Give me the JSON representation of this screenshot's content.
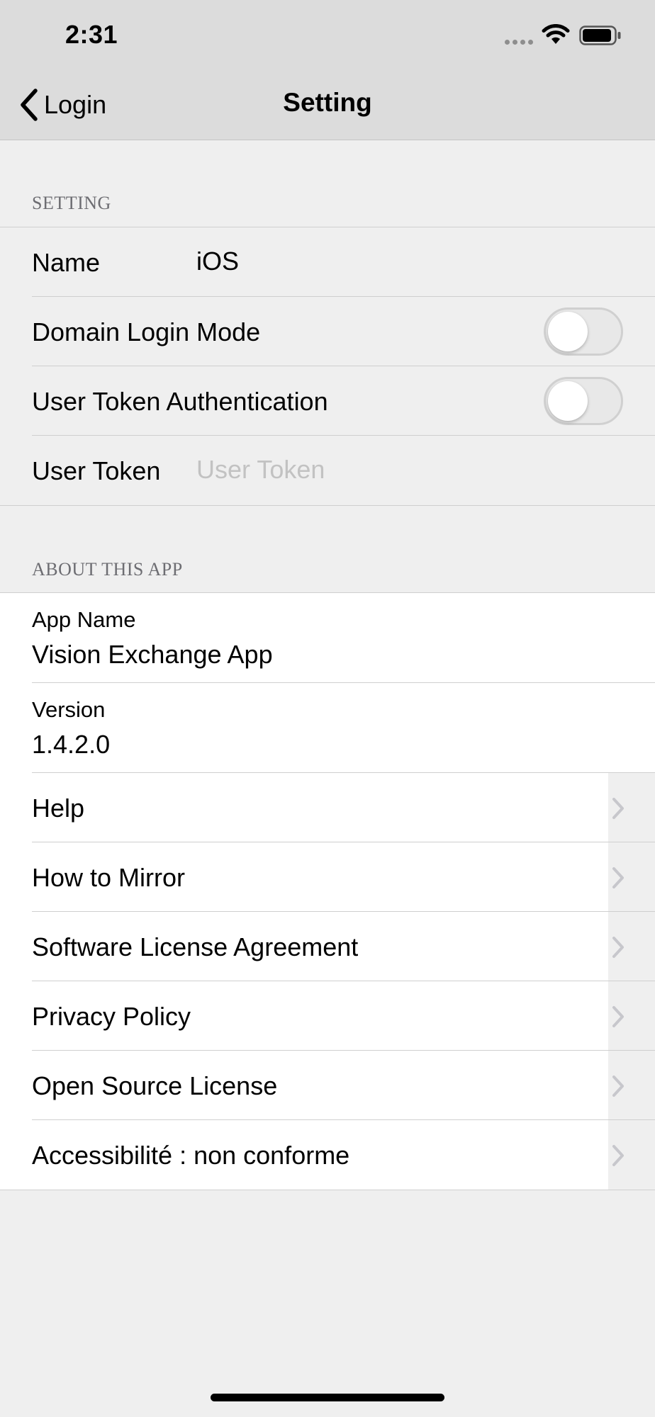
{
  "status_bar": {
    "time": "2:31"
  },
  "nav": {
    "back_label": "Login",
    "title": "Setting"
  },
  "setting_section": {
    "header": "SETTING",
    "name_label": "Name",
    "name_value": "iOS",
    "domain_login_label": "Domain Login Mode",
    "domain_login_on": false,
    "user_token_auth_label": "User Token Authentication",
    "user_token_auth_on": false,
    "user_token_label": "User Token",
    "user_token_placeholder": "User Token"
  },
  "about_section": {
    "header": "ABOUT THIS APP",
    "app_name_label": "App Name",
    "app_name_value": "Vision Exchange App",
    "version_label": "Version",
    "version_value": "1.4.2.0",
    "links": [
      {
        "label": "Help"
      },
      {
        "label": "How to Mirror"
      },
      {
        "label": "Software License Agreement"
      },
      {
        "label": "Privacy Policy"
      },
      {
        "label": "Open Source License"
      },
      {
        "label": "Accessibilité : non conforme"
      }
    ]
  },
  "colors": {
    "background": "#efefef",
    "nav_bar": "#dcdcdc",
    "placeholder": "#c2c2c2",
    "section_header": "#6d6d72"
  },
  "icons": [
    "back-chevron-icon",
    "cellular-signal-icon",
    "wifi-icon",
    "battery-icon",
    "chevron-right-icon"
  ]
}
